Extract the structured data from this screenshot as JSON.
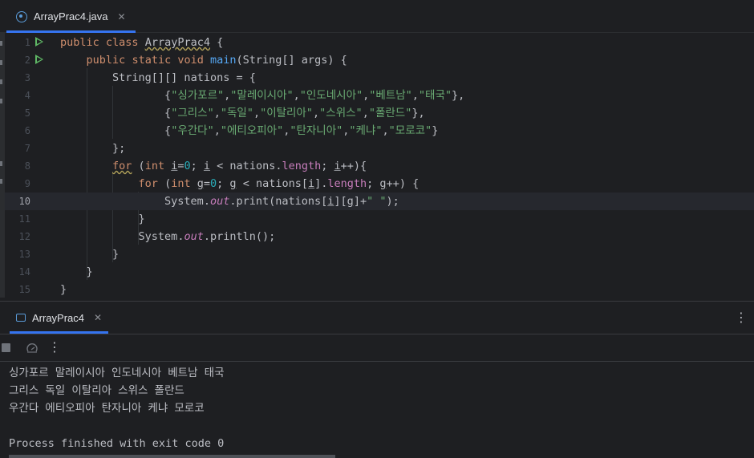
{
  "editor": {
    "tab": {
      "icon": "java-class-icon",
      "label": "ArrayPrac4.java"
    },
    "current_line": 10,
    "lines": [
      {
        "num": "1",
        "run": true
      },
      {
        "num": "2",
        "run": true
      },
      {
        "num": "3"
      },
      {
        "num": "4"
      },
      {
        "num": "5"
      },
      {
        "num": "6"
      },
      {
        "num": "7"
      },
      {
        "num": "8"
      },
      {
        "num": "9"
      },
      {
        "num": "10"
      },
      {
        "num": "11"
      },
      {
        "num": "12"
      },
      {
        "num": "13"
      },
      {
        "num": "14"
      },
      {
        "num": "15"
      }
    ],
    "code": {
      "l1": {
        "kw1": "public",
        "kw2": "class",
        "name": "ArrayPrac4",
        "brace": " {"
      },
      "l2": {
        "kw1": "public",
        "kw2": "static",
        "kw3": "void",
        "fn": "main",
        "rest": "(String[] args) {"
      },
      "l3": {
        "text": "String[][] nations = {"
      },
      "l4": {
        "open": "{",
        "s1": "\"싱가포르\"",
        "s2": "\"말레이시아\"",
        "s3": "\"인도네시아\"",
        "s4": "\"베트남\"",
        "s5": "\"태국\"",
        "close": "},"
      },
      "l5": {
        "open": "{",
        "s1": "\"그리스\"",
        "s2": "\"독일\"",
        "s3": "\"이탈리아\"",
        "s4": "\"스위스\"",
        "s5": "\"폴란드\"",
        "close": "},"
      },
      "l6": {
        "open": "{",
        "s1": "\"우간다\"",
        "s2": "\"에티오피아\"",
        "s3": "\"탄자니아\"",
        "s4": "\"케냐\"",
        "s5": "\"모로코\"",
        "close": "}"
      },
      "l7": {
        "text": "};"
      },
      "l8": {
        "kw": "for",
        "p1": " (",
        "kw2": "int",
        "v1": "i",
        "eq": "=",
        "n0": "0",
        "sc": "; ",
        "v2": "i",
        "lt": " < nations.",
        "len": "length",
        "sc2": "; ",
        "v3": "i",
        "inc": "++){"
      },
      "l9": {
        "kw": "for",
        "p1": " (",
        "kw2": "int",
        "v1": "g",
        "eq": "=",
        "n0": "0",
        "sc": "; ",
        "v2": "g",
        "lt": " < nations[",
        "vi": "i",
        "dot": "].",
        "len": "length",
        "sc2": "; ",
        "v3": "g",
        "inc": "++) {"
      },
      "l10": {
        "sys": "System.",
        "out": "out",
        "print": ".print(nations[",
        "vi": "i",
        "mid": "][",
        "vg": "g",
        "plus": "]+",
        "str": "\" \"",
        "end": ");"
      },
      "l11": {
        "text": "}"
      },
      "l12": {
        "sys": "System.",
        "out": "out",
        "rest": ".println();"
      },
      "l13": {
        "text": "}"
      },
      "l14": {
        "text": "}"
      },
      "l15": {
        "text": "}"
      }
    }
  },
  "run": {
    "tab": {
      "icon": "run-config-icon",
      "label": "ArrayPrac4"
    },
    "toolbar": {
      "stop_icon": "stop-icon",
      "rerun_icon": "rerun-icon",
      "more_icon": "more-vertical-icon"
    },
    "output": [
      "싱가포르 말레이시아 인도네시아 베트남 태국",
      "그리스 독일 이탈리아 스위스 폴란드",
      "우간다 에티오피아 탄자니아 케냐 모로코",
      "",
      "Process finished with exit code 0"
    ]
  },
  "colors": {
    "background": "#1e1f22",
    "keyword": "#cf8e6d",
    "string": "#6aab73",
    "method": "#56a8f5",
    "field": "#c77dbb",
    "number": "#2aacb8",
    "accent": "#3574f0",
    "run_green": "#5fb865"
  }
}
